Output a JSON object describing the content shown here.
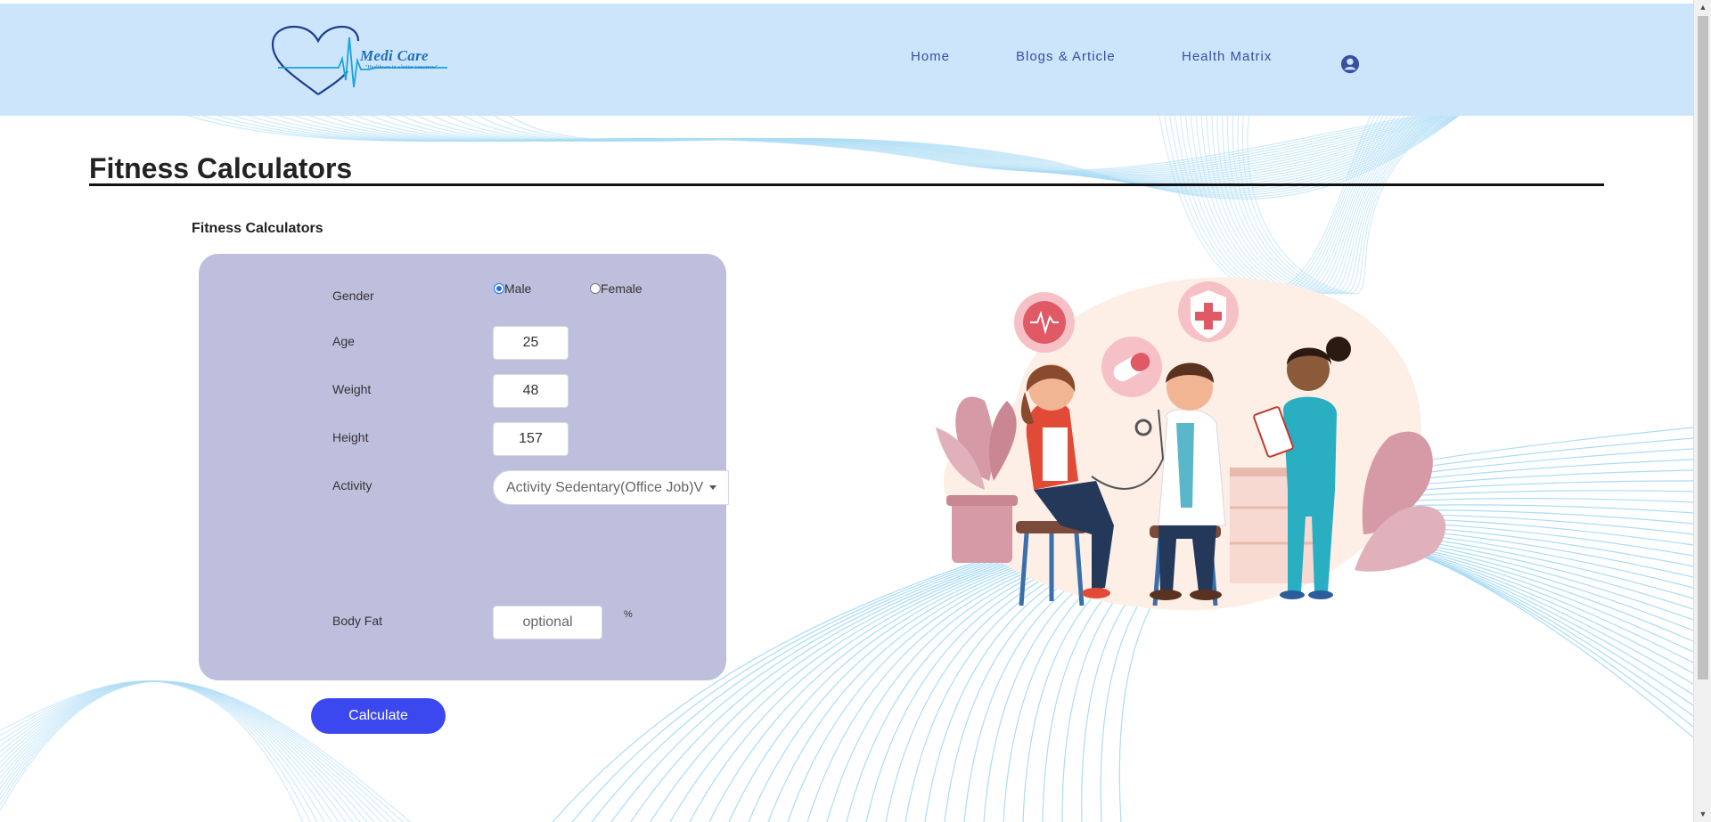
{
  "header": {
    "logo_text": "Medi Care",
    "logo_tagline": "\"Healthcare in a better tomorrow\"",
    "nav": [
      "Home",
      "Blogs & Article",
      "Health Matrix"
    ],
    "account_icon": "account-circle-icon"
  },
  "main": {
    "page_title": "Fitness Calculators",
    "section_title": "Fitness Calculators",
    "form": {
      "gender_label": "Gender",
      "gender_options": [
        "Male",
        "Female"
      ],
      "gender_selected": "Male",
      "age_label": "Age",
      "age_value": "25",
      "weight_label": "Weight",
      "weight_value": "48",
      "height_label": "Height",
      "height_value": "157",
      "activity_label": "Activity",
      "activity_value": "Activity Sedentary(Office Job)V",
      "bodyfat_label": "Body Fat",
      "bodyfat_placeholder": "optional",
      "bodyfat_unit": "%",
      "calculate_label": "Calculate"
    }
  },
  "colors": {
    "header_bg": "#cce5fb",
    "card_bg": "#bebfdc",
    "button_bg": "#3b48ef",
    "nav_text": "#3a4fa0"
  }
}
